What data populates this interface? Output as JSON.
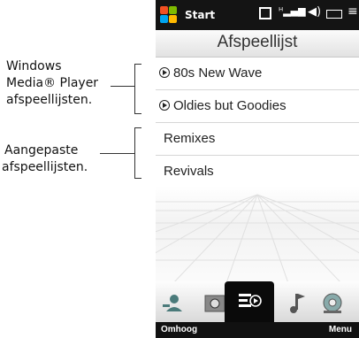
{
  "callouts": {
    "wmp_playlists": [
      "Windows",
      "Media® Player",
      "afspeellijsten."
    ],
    "custom_playlists": [
      "Aangepaste",
      "afspeellijsten."
    ]
  },
  "statusbar": {
    "start_label": "Start",
    "icons": [
      "windows-flag-icon",
      "data-connection-icon",
      "signal-strength-icon",
      "speaker-icon",
      "battery-icon",
      "more-icon"
    ]
  },
  "header": {
    "title": "Afspeellijst"
  },
  "playlists": [
    {
      "label": "80s New Wave",
      "kind": "wmp"
    },
    {
      "label": "Oldies but Goodies",
      "kind": "wmp"
    },
    {
      "label": "Remixes",
      "kind": "custom"
    },
    {
      "label": "Revivals",
      "kind": "custom"
    }
  ],
  "tabs": [
    {
      "name": "people-tab",
      "icon": "people-icon"
    },
    {
      "name": "photos-tab",
      "icon": "photo-frame-icon"
    },
    {
      "name": "playlists-tab",
      "icon": "playlist-icon",
      "active": true
    },
    {
      "name": "music-tab",
      "icon": "music-note-icon"
    },
    {
      "name": "weather-tab",
      "icon": "disc-icon"
    }
  ],
  "softkeys": {
    "left": "Omhoog",
    "right": "Menu"
  },
  "colors": {
    "statusbar": "#141414",
    "active_tab": "#0a0a0a",
    "softbar": "#111111"
  }
}
